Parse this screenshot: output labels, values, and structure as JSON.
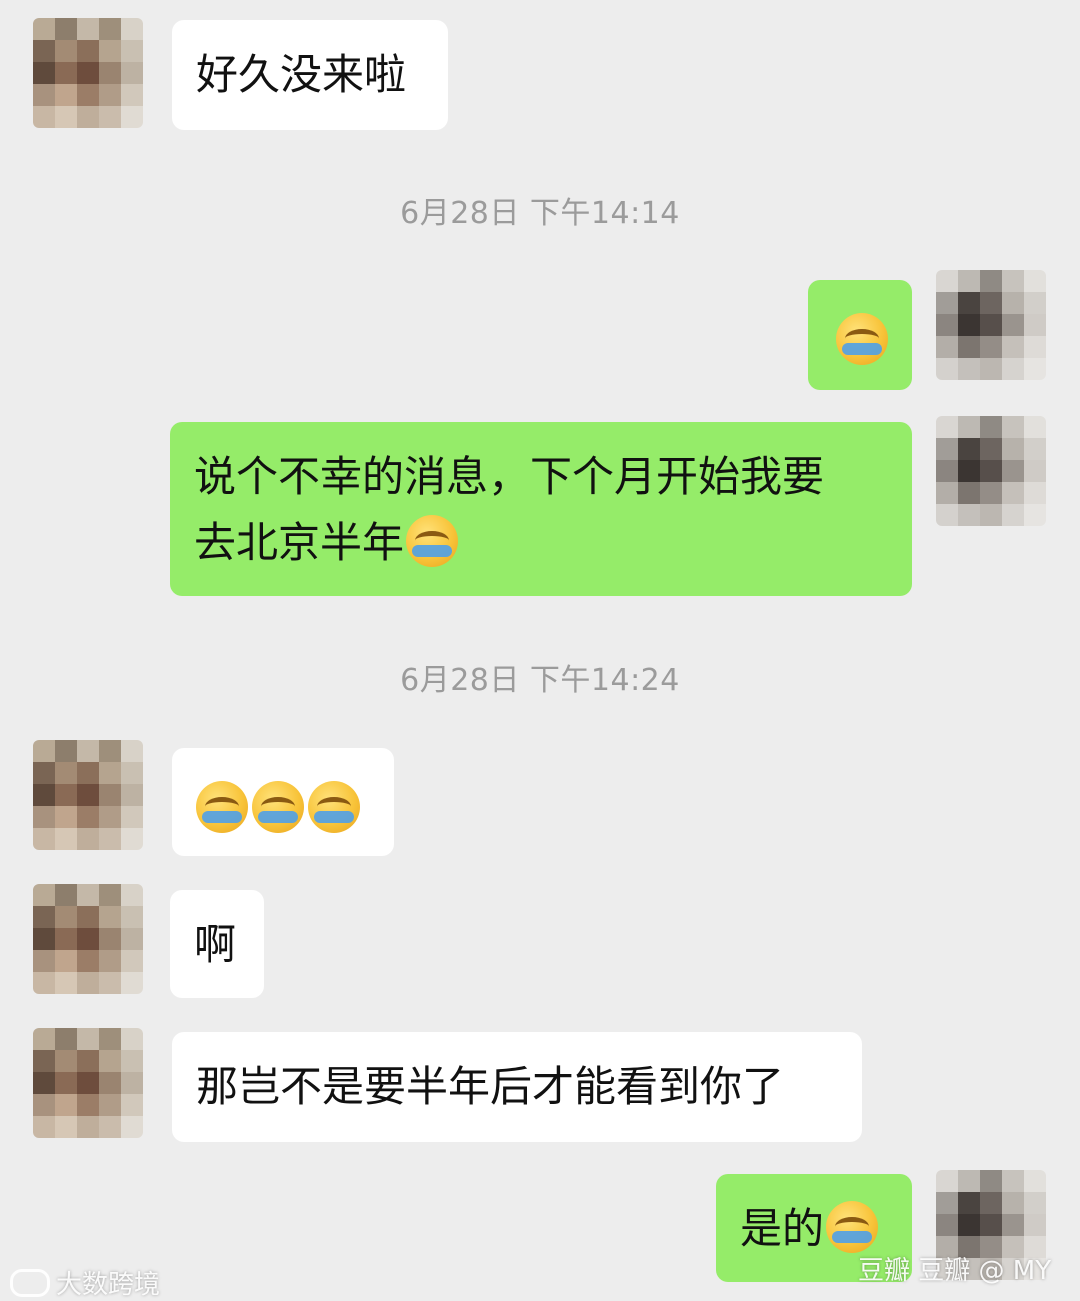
{
  "timestamps": {
    "first": "6月28日 下午14:14",
    "second": "6月28日 下午14:24"
  },
  "messages": {
    "m1": "好久没来啦",
    "m2_emoji": "face-palm-crying-emoji",
    "m3": "说个不幸的消息，下个月开始我要",
    "m3_line2": "去北京半年",
    "m4_emoji": "face-palm-crying-emoji x3",
    "m5": "啊",
    "m6": "那岂不是要半年后才能看到你了",
    "m7": "是的"
  },
  "watermarks": {
    "left": "大数跨境",
    "right": "豆瓣 豆瓣 @ MY"
  },
  "colors": {
    "background": "#ededed",
    "sent_bubble": "#95ec69",
    "received_bubble": "#ffffff",
    "timestamp_text": "#9b9b9b"
  }
}
